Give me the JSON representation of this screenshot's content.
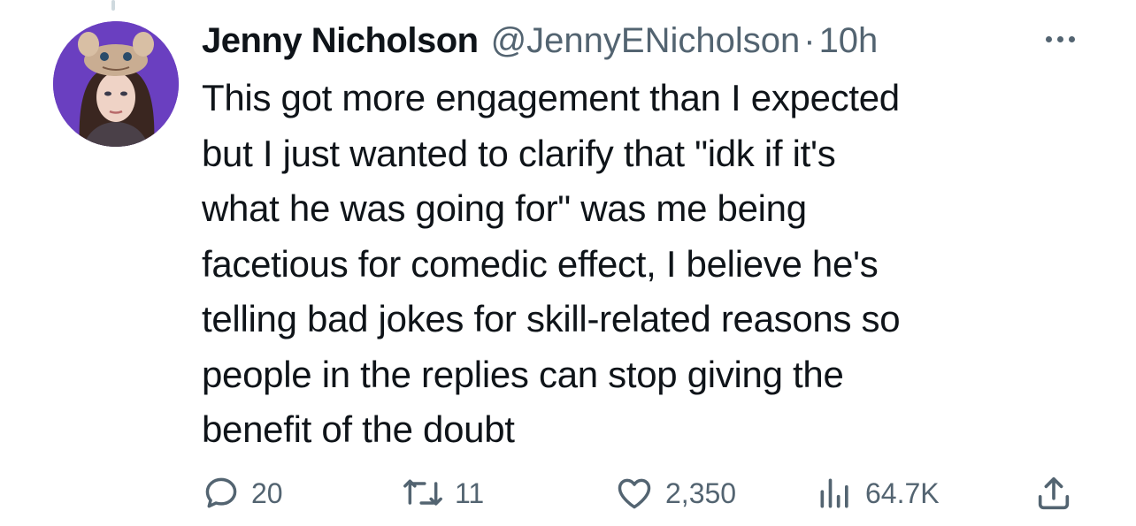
{
  "tweet": {
    "author_name": "Jenny Nicholson",
    "handle": "@JennyENicholson",
    "separator": "·",
    "time": "10h",
    "text": "This got more engagement than I expected\nbut I just wanted to clarify that \"idk if it's\nwhat he was going for\" was me being\nfacetious for comedic effect, I believe he's\ntelling bad jokes for skill-related reasons so\npeople in the replies can stop giving the\nbenefit of the doubt"
  },
  "actions": {
    "replies": "20",
    "retweets": "11",
    "likes": "2,350",
    "views": "64.7K"
  },
  "icons": {
    "reply": "reply-icon",
    "retweet": "retweet-icon",
    "like": "heart-icon",
    "views": "views-icon",
    "share": "share-icon",
    "more": "more-icon"
  },
  "colors": {
    "text": "#0f1419",
    "secondary": "#536471",
    "avatar_bg": "#6a3fc0"
  }
}
